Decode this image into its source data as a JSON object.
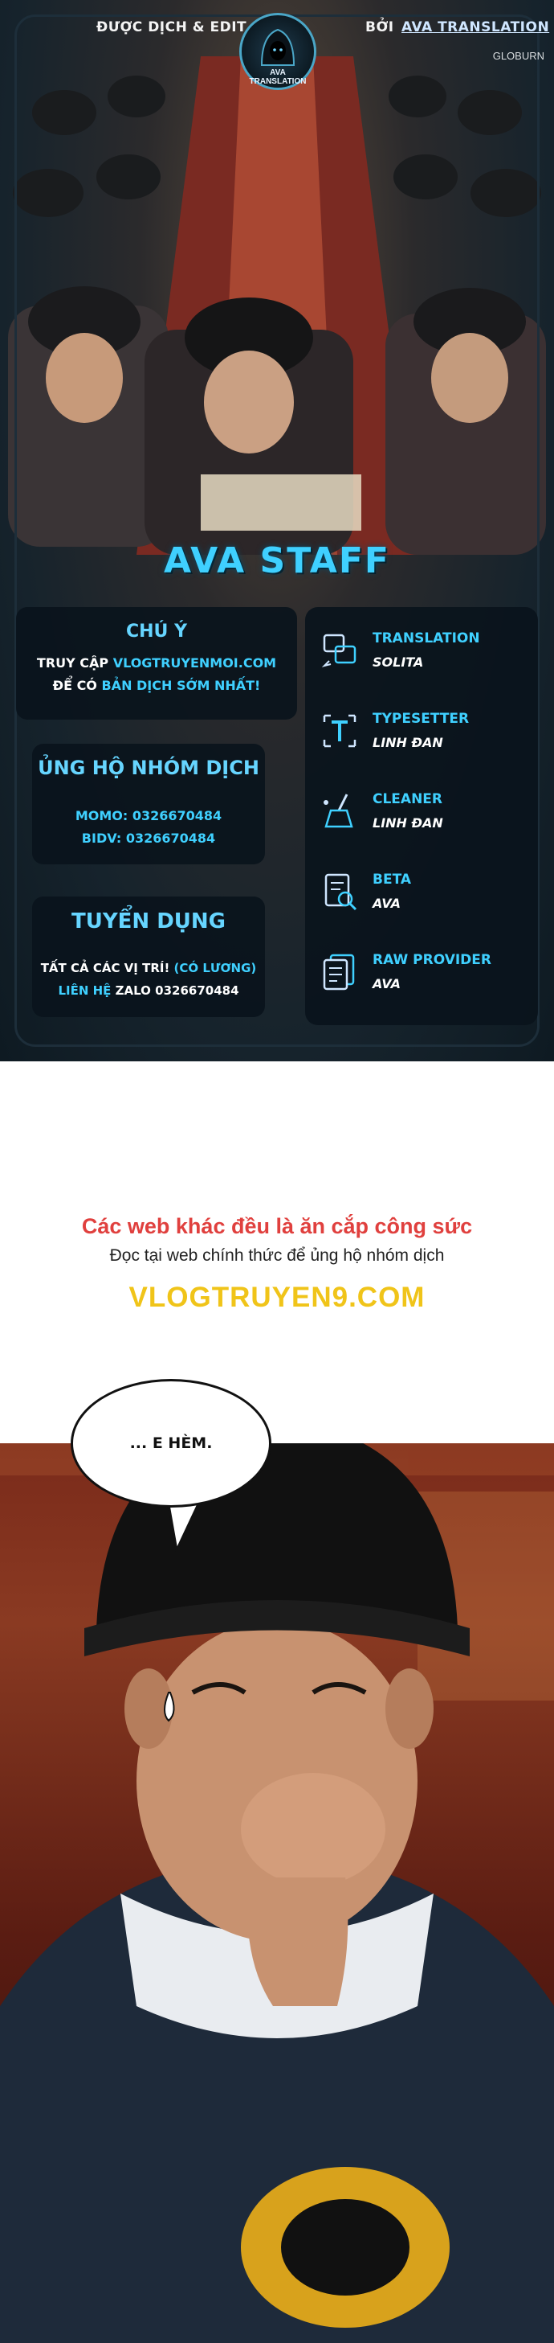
{
  "credits": {
    "left": "ĐƯỢC DỊCH & EDIT",
    "by": "BỞI",
    "team": "AVA TRANSLATION",
    "watermark": "GLOBURN",
    "logo_text": "AVA TRANSLATION"
  },
  "staff_title": "AVA STAFF",
  "notice_card": {
    "heading": "CHÚ Ý",
    "line1_prefix": "TRUY CẬP",
    "line1_link": "VLOGTRUYENMOI.COM",
    "line2_prefix": "ĐỂ CÓ",
    "line2_highlight": "BẢN DỊCH SỚM NHẤT!"
  },
  "support_card": {
    "heading": "ỦNG HỘ NHÓM DỊCH",
    "momo": "MOMO: 0326670484",
    "bidv": "BIDV: 0326670484"
  },
  "recruit_card": {
    "heading": "TUYỂN DỤNG",
    "line1_prefix": "TẤT CẢ CÁC VỊ TRÍ!",
    "line1_highlight": "(CÓ LƯƠNG)",
    "line2_highlight": "LIÊN HỆ",
    "line2_rest": "ZALO 0326670484"
  },
  "roles": [
    {
      "title": "TRANSLATION",
      "name": "SOLITA",
      "icon": "translate-icon"
    },
    {
      "title": "TYPESETTER",
      "name": "LINH ĐAN",
      "icon": "text-tool-icon"
    },
    {
      "title": "CLEANER",
      "name": "LINH ĐAN",
      "icon": "broom-icon"
    },
    {
      "title": "BETA",
      "name": "AVA",
      "icon": "document-search-icon"
    },
    {
      "title": "RAW PROVIDER",
      "name": "AVA",
      "icon": "document-stack-icon"
    }
  ],
  "notice": {
    "warning": "Các web khác đều là ăn cắp công sức",
    "instruction": "Đọc tại web chính thức để ủng hộ nhóm dịch",
    "site": "VLOGTRUYEN9.COM"
  },
  "speech_bubble": {
    "text": "... E HÈM."
  },
  "colors": {
    "accent": "#3fd0ff",
    "warning": "#e0403e",
    "site": "#f0c419"
  }
}
